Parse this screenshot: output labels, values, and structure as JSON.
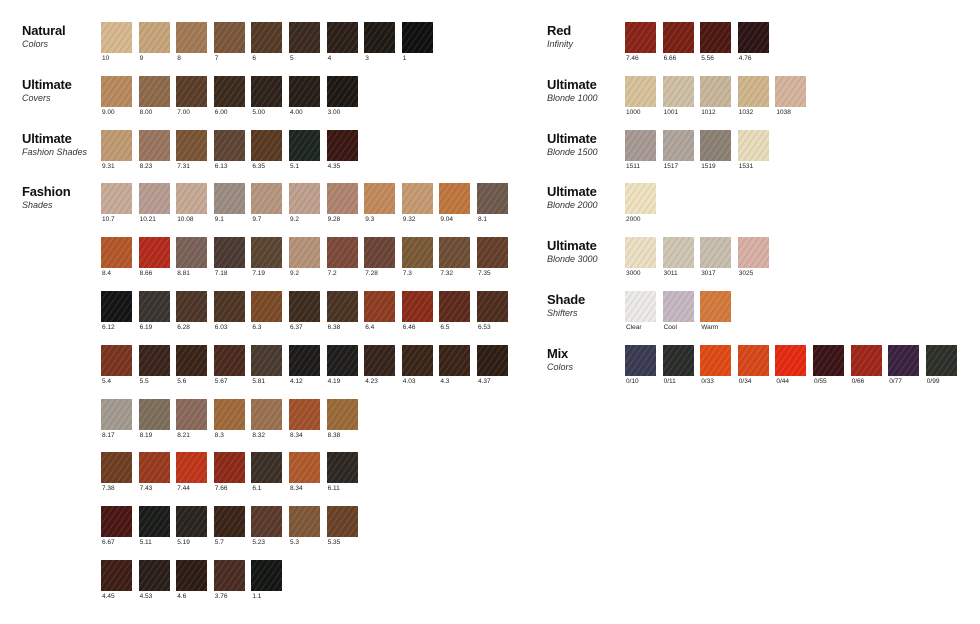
{
  "sections": [
    {
      "col": "left",
      "title": "Natural",
      "subtitle": "Colors",
      "rows": [
        [
          {
            "c": "10",
            "h": "#d8b98f"
          },
          {
            "c": "9",
            "h": "#c7a57a"
          },
          {
            "c": "8",
            "h": "#a47a55"
          },
          {
            "c": "7",
            "h": "#7c573a"
          },
          {
            "c": "6",
            "h": "#553b27"
          },
          {
            "c": "5",
            "h": "#3b2a1f"
          },
          {
            "c": "4",
            "h": "#2c2119"
          },
          {
            "c": "3",
            "h": "#201a15"
          },
          {
            "c": "1",
            "h": "#111010"
          }
        ]
      ]
    },
    {
      "col": "left",
      "title": "Ultimate",
      "subtitle": "Covers",
      "rows": [
        [
          {
            "c": "9.00",
            "h": "#b98a5e"
          },
          {
            "c": "8.00",
            "h": "#8e6a4b"
          },
          {
            "c": "7.00",
            "h": "#5b3e29"
          },
          {
            "c": "6.00",
            "h": "#3c2a1e"
          },
          {
            "c": "5.00",
            "h": "#2e231b"
          },
          {
            "c": "4.00",
            "h": "#261e17"
          },
          {
            "c": "3.00",
            "h": "#1e1814"
          }
        ]
      ]
    },
    {
      "col": "left",
      "title": "Ultimate",
      "subtitle": "Fashion Shades",
      "rows": [
        [
          {
            "c": "9.31",
            "h": "#c09a73"
          },
          {
            "c": "8.23",
            "h": "#9a7560"
          },
          {
            "c": "7.31",
            "h": "#7a5535"
          },
          {
            "c": "6.13",
            "h": "#5e4535"
          },
          {
            "c": "6.35",
            "h": "#5a3a22"
          },
          {
            "c": "5.1",
            "h": "#1e2620"
          },
          {
            "c": "4.35",
            "h": "#3a1712"
          }
        ]
      ]
    },
    {
      "col": "left",
      "title": "Fashion",
      "subtitle": "Shades",
      "rows": [
        [
          {
            "c": "10.7",
            "h": "#c8ab98"
          },
          {
            "c": "10.21",
            "h": "#b89c92"
          },
          {
            "c": "10.08",
            "h": "#c7aa96"
          },
          {
            "c": "9.1",
            "h": "#9c8c83"
          },
          {
            "c": "9.7",
            "h": "#b69680"
          },
          {
            "c": "9.2",
            "h": "#c0a08e"
          },
          {
            "c": "9.28",
            "h": "#b08570"
          },
          {
            "c": "9.3",
            "h": "#c28a5c"
          },
          {
            "c": "9.32",
            "h": "#c59a72"
          },
          {
            "c": "9.04",
            "h": "#c0773f"
          },
          {
            "c": "8.1",
            "h": "#6e5a4e"
          }
        ],
        [
          {
            "c": "8.4",
            "h": "#b4582a"
          },
          {
            "c": "8.66",
            "h": "#b42a1c"
          },
          {
            "c": "8.81",
            "h": "#7a6258"
          },
          {
            "c": "7.18",
            "h": "#4b3a33"
          },
          {
            "c": "7.19",
            "h": "#5a4632"
          },
          {
            "c": "9.2",
            "h": "#b69379"
          },
          {
            "c": "7.2",
            "h": "#7d4a3a"
          },
          {
            "c": "7.28",
            "h": "#6b4438"
          },
          {
            "c": "7.3",
            "h": "#7b5a36"
          },
          {
            "c": "7.32",
            "h": "#6e4f36"
          },
          {
            "c": "7.35",
            "h": "#64402a"
          }
        ],
        [
          {
            "c": "6.12",
            "h": "#141414"
          },
          {
            "c": "6.19",
            "h": "#3a3430"
          },
          {
            "c": "6.28",
            "h": "#4e3628"
          },
          {
            "c": "6.03",
            "h": "#4e3624"
          },
          {
            "c": "6.3",
            "h": "#7b4a26"
          },
          {
            "c": "6.37",
            "h": "#3e2c1e"
          },
          {
            "c": "6.38",
            "h": "#4a3424"
          },
          {
            "c": "6.4",
            "h": "#8e3c22"
          },
          {
            "c": "6.46",
            "h": "#8a2c1a"
          },
          {
            "c": "6.5",
            "h": "#5e2a1c"
          },
          {
            "c": "6.53",
            "h": "#4e2e1e"
          }
        ],
        [
          {
            "c": "5.4",
            "h": "#7a3420"
          },
          {
            "c": "5.5",
            "h": "#3a241c"
          },
          {
            "c": "5.6",
            "h": "#3a2418"
          },
          {
            "c": "5.67",
            "h": "#4a2a1e"
          },
          {
            "c": "5.81",
            "h": "#4a3a30"
          },
          {
            "c": "4.12",
            "h": "#1e1c1a"
          },
          {
            "c": "4.19",
            "h": "#201e1c"
          },
          {
            "c": "4.23",
            "h": "#36241c"
          },
          {
            "c": "4.03",
            "h": "#3a2618"
          },
          {
            "c": "4.3",
            "h": "#3a2418"
          },
          {
            "c": "4.37",
            "h": "#2e1e14"
          }
        ],
        [
          {
            "c": "8.17",
            "h": "#a49a90"
          },
          {
            "c": "8.19",
            "h": "#7e6e5c"
          },
          {
            "c": "8.21",
            "h": "#8a6a5c"
          },
          {
            "c": "8.3",
            "h": "#a06a3a"
          },
          {
            "c": "8.32",
            "h": "#9a7250"
          },
          {
            "c": "8.34",
            "h": "#a2522a"
          },
          {
            "c": "8.38",
            "h": "#9c6a38"
          }
        ],
        [
          {
            "c": "7.38",
            "h": "#6e3e22"
          },
          {
            "c": "7.43",
            "h": "#9a3a1e"
          },
          {
            "c": "7.44",
            "h": "#c0361a"
          },
          {
            "c": "7.66",
            "h": "#8e2a18"
          },
          {
            "c": "6.1",
            "h": "#3c3026"
          },
          {
            "c": "8.34",
            "h": "#b05a2c"
          },
          {
            "c": "6.11",
            "h": "#2e2824"
          }
        ],
        [
          {
            "c": "6.67",
            "h": "#4a1614"
          },
          {
            "c": "5.11",
            "h": "#1a1c1a"
          },
          {
            "c": "5.19",
            "h": "#2a2420"
          },
          {
            "c": "5.7",
            "h": "#3a2418"
          },
          {
            "c": "5.23",
            "h": "#5a3a2c"
          },
          {
            "c": "5.3",
            "h": "#805838"
          },
          {
            "c": "5.35",
            "h": "#6a4228"
          }
        ],
        [
          {
            "c": "4.45",
            "h": "#3e1e16"
          },
          {
            "c": "4.53",
            "h": "#2a1e18"
          },
          {
            "c": "4.6",
            "h": "#2e1c14"
          },
          {
            "c": "3.76",
            "h": "#4a2c22"
          },
          {
            "c": "1.1",
            "h": "#141614"
          }
        ]
      ]
    },
    {
      "col": "right",
      "title": "Red",
      "subtitle": "Infinity",
      "rows": [
        [
          {
            "c": "7.46",
            "h": "#8a2418"
          },
          {
            "c": "6.66",
            "h": "#7a2014"
          },
          {
            "c": "5.56",
            "h": "#4e1812"
          },
          {
            "c": "4.76",
            "h": "#2e1414"
          }
        ]
      ]
    },
    {
      "col": "right",
      "title": "Ultimate",
      "subtitle": "Blonde 1000",
      "rows": [
        [
          {
            "c": "1000",
            "h": "#d8c29a"
          },
          {
            "c": "1001",
            "h": "#cfc0a6"
          },
          {
            "c": "1012",
            "h": "#c8b69a"
          },
          {
            "c": "1032",
            "h": "#d0b68c"
          },
          {
            "c": "1038",
            "h": "#d6b49c"
          }
        ]
      ]
    },
    {
      "col": "right",
      "title": "Ultimate",
      "subtitle": "Blonde 1500",
      "rows": [
        [
          {
            "c": "1511",
            "h": "#a89a94"
          },
          {
            "c": "1517",
            "h": "#b0a59c"
          },
          {
            "c": "1519",
            "h": "#8c8174"
          },
          {
            "c": "1531",
            "h": "#e8dcbc"
          }
        ]
      ]
    },
    {
      "col": "right",
      "title": "Ultimate",
      "subtitle": "Blonde 2000",
      "rows": [
        [
          {
            "c": "2000",
            "h": "#efe2c0"
          }
        ]
      ]
    },
    {
      "col": "right",
      "title": "Ultimate",
      "subtitle": "Blonde 3000",
      "rows": [
        [
          {
            "c": "3000",
            "h": "#ece0c4"
          },
          {
            "c": "3011",
            "h": "#cfc6b4"
          },
          {
            "c": "3017",
            "h": "#c8beae"
          },
          {
            "c": "3025",
            "h": "#d8b0a4"
          }
        ]
      ]
    },
    {
      "col": "right",
      "title": "Shade",
      "subtitle": "Shifters",
      "rows": [
        [
          {
            "c": "Clear",
            "h": "#ecebea"
          },
          {
            "c": "Cool",
            "h": "#c6b8c2"
          },
          {
            "c": "Warm",
            "h": "#d47a3c"
          }
        ]
      ]
    },
    {
      "col": "right",
      "title": "Mix",
      "subtitle": "Colors",
      "rows": [
        [
          {
            "c": "0/10",
            "h": "#3a3a52"
          },
          {
            "c": "0/11",
            "h": "#2a2c2a"
          },
          {
            "c": "0/33",
            "h": "#e04a14"
          },
          {
            "c": "0/34",
            "h": "#d8481a"
          },
          {
            "c": "0/44",
            "h": "#e62a12"
          },
          {
            "c": "0/55",
            "h": "#3a1416"
          },
          {
            "c": "0/66",
            "h": "#a0261a"
          },
          {
            "c": "0/77",
            "h": "#3a2240"
          },
          {
            "c": "0/99",
            "h": "#2e302a"
          }
        ]
      ]
    }
  ]
}
